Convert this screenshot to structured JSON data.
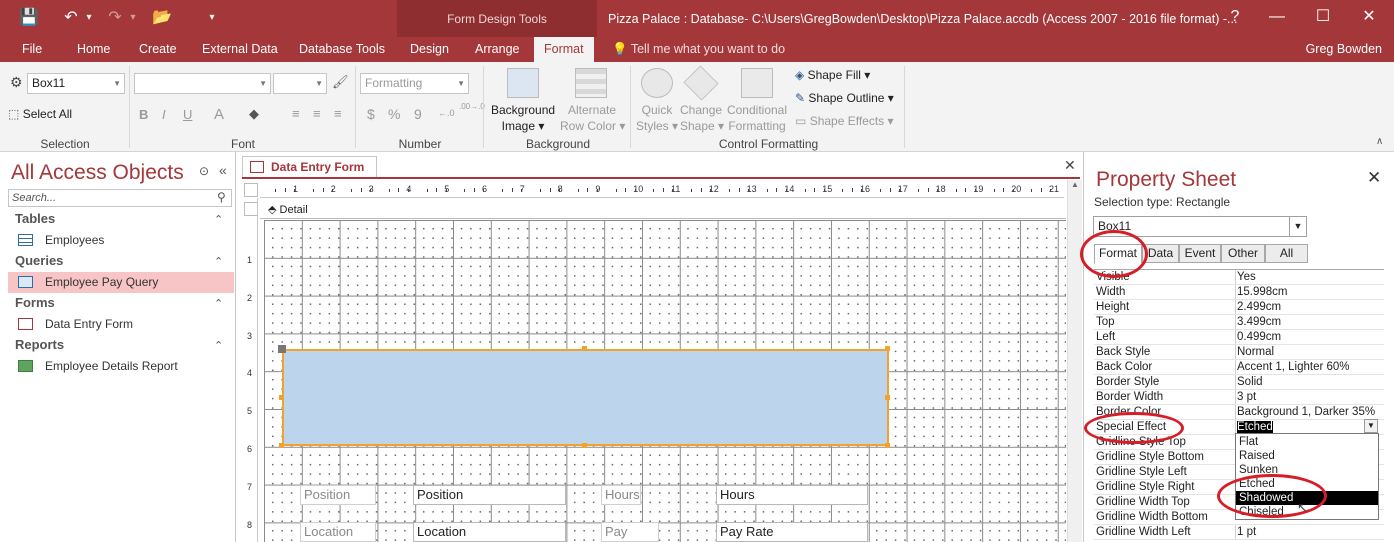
{
  "titlebar": {
    "context_group": "Form Design Tools",
    "doc_title": "Pizza Palace : Database- C:\\Users\\GregBowden\\Desktop\\Pizza Palace.accdb (Access 2007 - 2016 file format) -...",
    "qa_save": "💾",
    "qa_undo": "↶",
    "qa_undo_dd": "▾",
    "qa_redo": "↷",
    "qa_redo_dd": "▾",
    "qa_open": "📂",
    "qa_customize": "▾",
    "win_help": "?",
    "win_min": "—",
    "win_max": "☐",
    "win_close": "✕"
  },
  "tabs": [
    "File",
    "Home",
    "Create",
    "External Data",
    "Database Tools",
    "Design",
    "Arrange",
    "Format"
  ],
  "tell_me": "Tell me what you want to do",
  "tell_me_icon": "💡",
  "user": "Greg Bowden",
  "ribbon": {
    "selection": {
      "object_combo": "Box11",
      "select_all": "Select All",
      "group_label": "Selection"
    },
    "font": {
      "bold": "B",
      "italic": "I",
      "underline": "U",
      "font_color": "A",
      "fill": "◆",
      "align_left": "≡",
      "align_center": "≡",
      "align_right": "≡",
      "group_label": "Font"
    },
    "number": {
      "format_combo": "Formatting",
      "currency": "$",
      "percent": "%",
      "comma": "9",
      "inc_dec": "←.0",
      "dec_dec": ".00→.0",
      "group_label": "Number"
    },
    "background": {
      "bg_image": "Background",
      "bg_image2": "Image",
      "alt_row": "Alternate",
      "alt_row2": "Row Color",
      "group_label": "Background"
    },
    "control_formatting": {
      "quick_styles": "Quick",
      "quick_styles2": "Styles",
      "change_shape": "Change",
      "change_shape2": "Shape",
      "conditional": "Conditional",
      "conditional2": "Formatting",
      "shape_fill": "Shape Fill",
      "shape_outline": "Shape Outline",
      "shape_effects": "Shape Effects",
      "group_label": "Control Formatting"
    }
  },
  "nav": {
    "title": "All Access Objects",
    "search_placeholder": "Search...",
    "sections": [
      {
        "label": "Tables",
        "items": [
          "Employees"
        ]
      },
      {
        "label": "Queries",
        "items": [
          "Employee Pay Query"
        ]
      },
      {
        "label": "Forms",
        "items": [
          "Data Entry Form"
        ]
      },
      {
        "label": "Reports",
        "items": [
          "Employee Details Report"
        ]
      }
    ]
  },
  "document": {
    "tab_label": "Data Entry Form",
    "detail_label": "Detail",
    "ruler_top": [
      "1",
      "2",
      "3",
      "4",
      "5",
      "6",
      "7",
      "8",
      "9",
      "10",
      "11",
      "12",
      "13",
      "14",
      "15",
      "16",
      "17",
      "18",
      "19",
      "20",
      "21"
    ],
    "ruler_left": [
      "1",
      "2",
      "3",
      "4",
      "5",
      "6",
      "7",
      "8"
    ],
    "controls": {
      "position_label": "Position",
      "position_field": "Position",
      "hours_label": "Hours",
      "hours_field": "Hours",
      "location_label": "Location",
      "location_field": "Location",
      "payrate_label": "Pay Rate",
      "payrate_field": "Pay Rate"
    }
  },
  "property_sheet": {
    "title": "Property Sheet",
    "selection_type": "Selection type:  Rectangle",
    "object": "Box11",
    "tabs": [
      "Format",
      "Data",
      "Event",
      "Other",
      "All"
    ],
    "rows": [
      {
        "name": "Visible",
        "value": "Yes"
      },
      {
        "name": "Width",
        "value": "15.998cm"
      },
      {
        "name": "Height",
        "value": "2.499cm"
      },
      {
        "name": "Top",
        "value": "3.499cm"
      },
      {
        "name": "Left",
        "value": "0.499cm"
      },
      {
        "name": "Back Style",
        "value": "Normal"
      },
      {
        "name": "Back Color",
        "value": "Accent 1, Lighter 60%"
      },
      {
        "name": "Border Style",
        "value": "Solid"
      },
      {
        "name": "Border Width",
        "value": "3 pt"
      },
      {
        "name": "Border Color",
        "value": "Background 1, Darker 35%"
      },
      {
        "name": "Special Effect",
        "value": "Etched"
      },
      {
        "name": "Gridline Style Top",
        "value": ""
      },
      {
        "name": "Gridline Style Bottom",
        "value": ""
      },
      {
        "name": "Gridline Style Left",
        "value": ""
      },
      {
        "name": "Gridline Style Right",
        "value": ""
      },
      {
        "name": "Gridline Width Top",
        "value": ""
      },
      {
        "name": "Gridline Width Bottom",
        "value": ""
      },
      {
        "name": "Gridline Width Left",
        "value": "1 pt"
      }
    ],
    "dropdown_options": [
      "Flat",
      "Raised",
      "Sunken",
      "Etched",
      "Shadowed",
      "Chiseled"
    ],
    "dropdown_selected": "Shadowed"
  },
  "colors": {
    "accent": "#a4373a",
    "box_fill": "#bcd5ec",
    "box_border": "#f0a32e",
    "annotation": "#d51e27"
  }
}
